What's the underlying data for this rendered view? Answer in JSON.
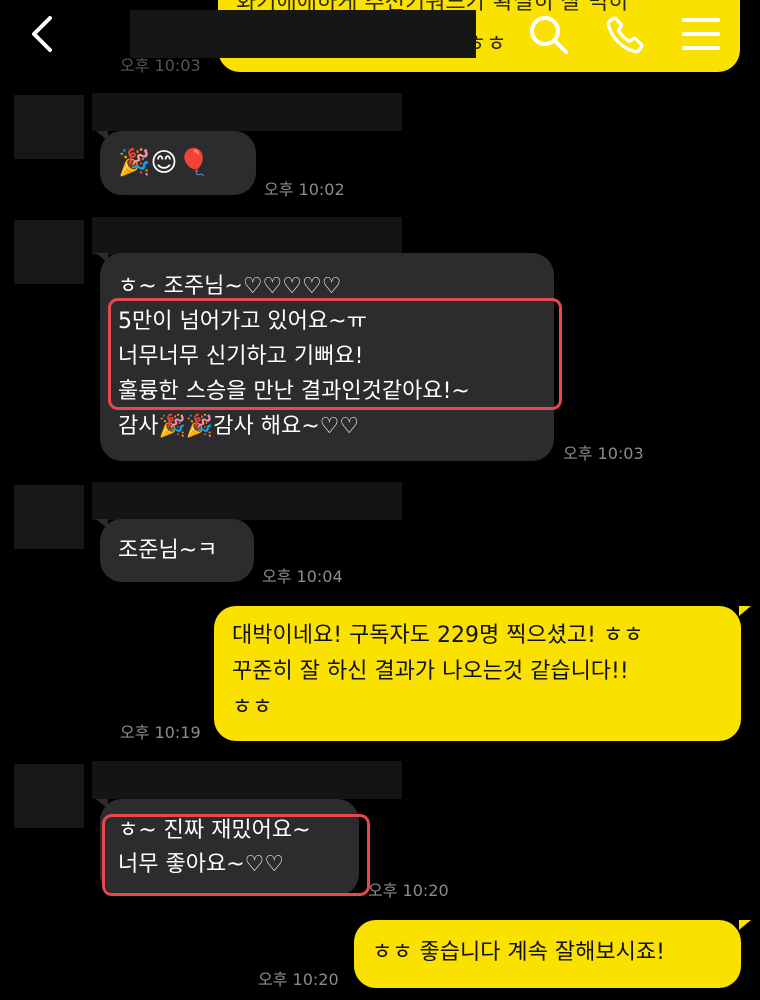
{
  "header": {
    "peek_line1": "화기애애하게 추천키워드가 확실히 잘 먹히",
    "peek_line2": "ㅎㅎ",
    "date_peek": "오후 10:03"
  },
  "messages": [
    {
      "sender": "other",
      "lines": [
        "🎉😊🎈"
      ],
      "time": "오후 10:02"
    },
    {
      "sender": "other",
      "lines": [
        "ㅎ~ 조주님~♡♡♡♡♡",
        "5만이 넘어가고 있어요~ㅠ",
        "너무너무 신기하고 기뻐요!",
        "훌륭한 스승을 만난 결과인것같아요!~",
        "감사🎉🎉감사 해요~♡♡"
      ],
      "time": "오후 10:03"
    },
    {
      "sender": "other",
      "lines": [
        "조준님~ㅋ"
      ],
      "time": "오후 10:04"
    },
    {
      "sender": "me",
      "lines": [
        "대박이네요! 구독자도 229명 찍으셨고! ㅎㅎ",
        "꾸준히 잘 하신 결과가 나오는것 같습니다!!",
        "ㅎㅎ"
      ],
      "time": "오후 10:19"
    },
    {
      "sender": "other",
      "lines": [
        "ㅎ~ 진짜 재밌어요~",
        "너무 좋아요~♡♡"
      ],
      "time": "오후 10:20"
    },
    {
      "sender": "me",
      "lines": [
        "ㅎㅎ 좋습니다 계속 잘해보시죠!"
      ],
      "time": "오후 10:20"
    }
  ],
  "icons": [
    "back-arrow-icon",
    "search-icon",
    "phone-icon",
    "menu-icon"
  ],
  "colors": {
    "background": "#000000",
    "my_bubble": "#fae100",
    "other_bubble": "#2c2c2e",
    "highlight": "#e5484d",
    "timestamp": "#8c8c8c"
  }
}
